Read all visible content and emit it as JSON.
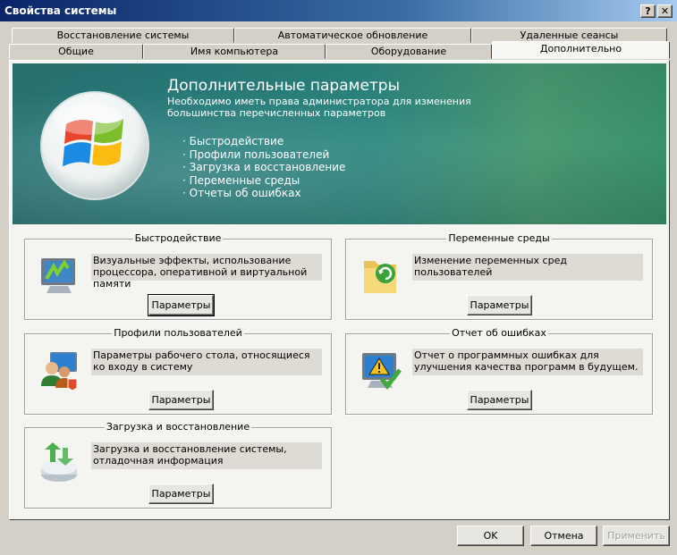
{
  "window": {
    "title": "Свойства системы",
    "help_label": "?",
    "close_label": "✕"
  },
  "tabs_row1": [
    {
      "label": "Восстановление системы"
    },
    {
      "label": "Автоматическое обновление"
    },
    {
      "label": "Удаленные сеансы"
    }
  ],
  "tabs_row2": [
    {
      "label": "Общие"
    },
    {
      "label": "Имя компьютера"
    },
    {
      "label": "Оборудование"
    },
    {
      "label": "Дополнительно",
      "active": true
    }
  ],
  "banner": {
    "title": "Дополнительные параметры",
    "subtitle": "Необходимо иметь права администратора для изменения большинства перечисленных параметров",
    "items": [
      "Быстродействие",
      "Профили пользователей",
      "Загрузка и восстановление",
      "Переменные среды",
      "Отчеты об ошибках"
    ]
  },
  "groups": {
    "performance": {
      "title": "Быстродействие",
      "description": "Визуальные эффекты, использование процессора, оперативной и виртуальной памяти",
      "button": "Параметры"
    },
    "profiles": {
      "title": "Профили пользователей",
      "description": "Параметры рабочего стола, относящиеся ко входу в систему",
      "button": "Параметры"
    },
    "startup": {
      "title": "Загрузка и восстановление",
      "description": "Загрузка и восстановление системы, отладочная информация",
      "button": "Параметры"
    },
    "environment": {
      "title": "Переменные среды",
      "description": "Изменение переменных сред пользователей",
      "button": "Параметры"
    },
    "errors": {
      "title": "Отчет об ошибках",
      "description": "Отчет о программных ошибках для улучшения качества программ в будущем.",
      "button": "Параметры"
    }
  },
  "footer": {
    "ok": "OK",
    "cancel": "Отмена",
    "apply": "Применить"
  }
}
